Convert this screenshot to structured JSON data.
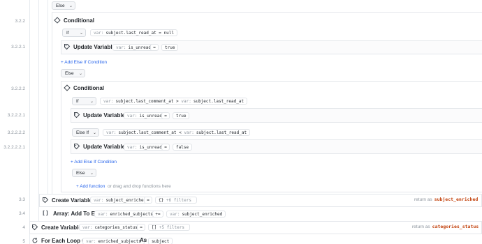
{
  "else1": "Else",
  "lines": {
    "l1": "3.2.2",
    "l2": "3.2.2.1",
    "l3": "3.2.2.2",
    "l4": "3.2.2.2.1",
    "l5": "3.2.2.2.2",
    "l6": "3.2.2.2.2.1",
    "l7": "3.3",
    "l8": "3.4",
    "l9": "4",
    "l10": "5"
  },
  "cond1": {
    "title": "Conditional",
    "if_label": "If",
    "expr_key": "var:",
    "expr": "subject.last_read_at = null",
    "update": {
      "title": "Update Variable",
      "key": "var:",
      "var": "is_unread",
      "op": "=",
      "value": "true"
    },
    "add_else_if": "+ Add Else If Condition",
    "else_label": "Else"
  },
  "cond2": {
    "title": "Conditional",
    "if_label": "If",
    "if_key": "var:",
    "if_expr": "subject.last_comment_at > ",
    "if_key2": "var:",
    "if_expr2": "subject.last_read_at",
    "update1": {
      "title": "Update Variable",
      "key": "var:",
      "var": "is_unread",
      "op": "=",
      "value": "true"
    },
    "elseif_label": "Else If",
    "elseif_key": "var:",
    "elseif_expr": "subject.last_comment_at < ",
    "elseif_key2": "var:",
    "elseif_expr2": "subject.last_read_at",
    "update2": {
      "title": "Update Variable",
      "key": "var:",
      "var": "is_unread",
      "op": "=",
      "value": "false"
    },
    "add_else_if": "+ Add Else If Condition",
    "else_label": "Else",
    "add_function": "+ Add function",
    "add_function_hint": "or drag and drop functions here"
  },
  "create1": {
    "title": "Create Variable",
    "key": "var:",
    "var": "subject_enriched",
    "op": "=",
    "value": "{}",
    "filters": "+6 filters",
    "return_label": "return as",
    "return_name": "subject_enriched"
  },
  "array": {
    "title": "Array: Add To End",
    "key": "var:",
    "var": "enriched_subjects",
    "op": "+=",
    "key2": "var:",
    "value": "subject_enriched"
  },
  "create2": {
    "title": "Create Variable",
    "key": "var:",
    "var": "categories_status",
    "op": "=",
    "value": "[]",
    "filters": "+5 filters",
    "return_label": "return as",
    "return_name": "categories_status"
  },
  "foreach": {
    "title": "For Each Loop On",
    "key": "var:",
    "var": "enriched_subjects",
    "as_label": "As",
    "as_var": "subject"
  },
  "icons": {
    "conditional": "diamond-icon",
    "variable": "tag-icon",
    "array": "brackets-icon",
    "loop": "loop-icon",
    "dropdown": "chevron-down-icon"
  }
}
